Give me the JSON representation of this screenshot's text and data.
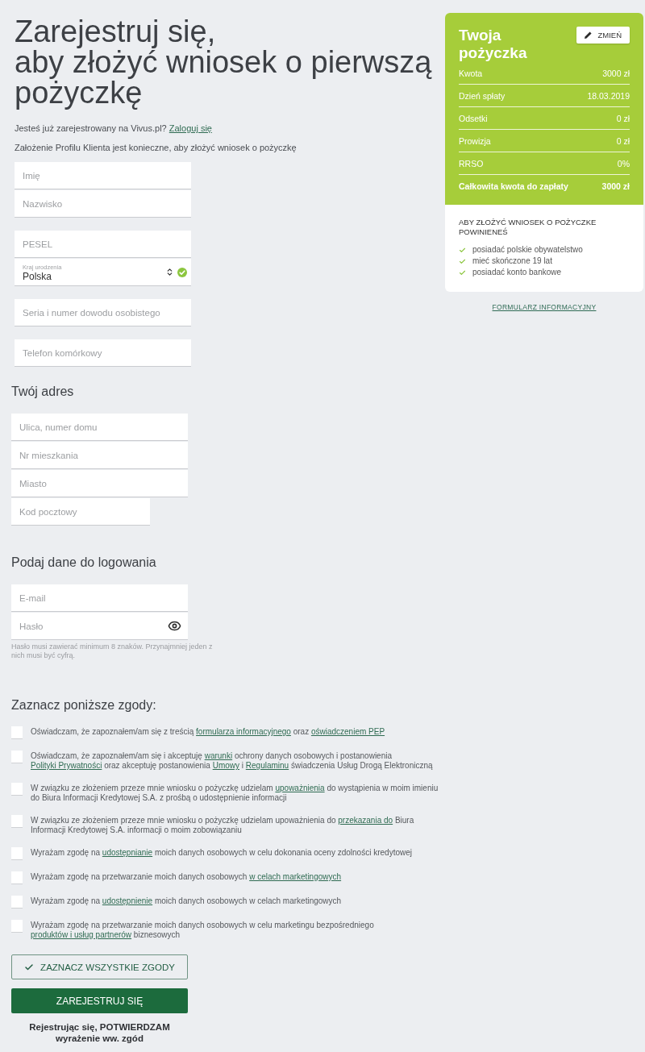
{
  "heading": "Zarejestruj się,\naby złożyć wniosek o pierwszą\npożyczkę",
  "login_prompt": [
    {
      "kind": "text",
      "text": "Jesteś już zarejestrowany na Vivus.pl? "
    },
    {
      "kind": "link",
      "text": "Zaloguj się"
    }
  ],
  "info_text": "Założenie Profilu Klienta jest konieczne, aby złożyć wniosek o pożyczkę",
  "personal_field_groups": [
    [
      {
        "kind": "text",
        "placeholder": "Imię"
      },
      {
        "kind": "text",
        "placeholder": "Nazwisko"
      }
    ],
    [
      {
        "kind": "text",
        "placeholder": "PESEL"
      },
      {
        "kind": "select",
        "label": "Kraj urodzenia",
        "value": "Polska",
        "valid": true
      }
    ],
    [
      {
        "kind": "text",
        "placeholder": "Seria i numer dowodu osobistego"
      }
    ],
    [
      {
        "kind": "text",
        "placeholder": "Telefon komórkowy"
      }
    ]
  ],
  "address": {
    "title": "Twój adres",
    "fields": [
      {
        "kind": "text",
        "placeholder": "Ulica, numer domu"
      },
      {
        "kind": "text",
        "placeholder": "Nr mieszkania"
      },
      {
        "kind": "text",
        "placeholder": "Miasto"
      },
      {
        "kind": "short",
        "placeholder": "Kod pocztowy"
      }
    ]
  },
  "login": {
    "title": "Podaj dane do logowania",
    "fields": [
      {
        "kind": "text",
        "placeholder": "E-mail"
      },
      {
        "kind": "password",
        "placeholder": "Hasło"
      }
    ],
    "hint": "Hasło musi zawierać minimum 8 znaków. Przynajmniej jeden z nich musi być cyfrą."
  },
  "consents": {
    "title": "Zaznacz poniższe zgody:",
    "items": [
      {
        "checked": false,
        "parts": [
          {
            "kind": "text",
            "text": "Oświadczam, że zapoznałem/am się z treścią "
          },
          {
            "kind": "link",
            "text": "formularza informacyjnego"
          },
          {
            "kind": "text",
            "text": " oraz "
          },
          {
            "kind": "link",
            "text": "oświadczeniem PEP"
          }
        ]
      },
      {
        "checked": false,
        "parts": [
          {
            "kind": "text",
            "text": "Oświadczam, że zapoznałem/am się i akceptuję "
          },
          {
            "kind": "link",
            "text": "warunki"
          },
          {
            "kind": "text",
            "text": " ochrony danych osobowych i postanowienia "
          },
          {
            "kind": "link",
            "text": "Polityki Prywatności"
          },
          {
            "kind": "text",
            "text": " oraz akceptuję postanowienia "
          },
          {
            "kind": "link",
            "text": "Umowy"
          },
          {
            "kind": "text",
            "text": " i "
          },
          {
            "kind": "link",
            "text": "Regulaminu"
          },
          {
            "kind": "text",
            "text": " świadczenia Usług Drogą Elektroniczną"
          }
        ]
      },
      {
        "checked": false,
        "parts": [
          {
            "kind": "text",
            "text": "W związku ze złożeniem przeze mnie wniosku o pożyczkę udzielam "
          },
          {
            "kind": "link",
            "text": "upoważnienia"
          },
          {
            "kind": "text",
            "text": " do wystąpienia w moim imieniu do Biura Informacji Kredytowej S.A. z prośbą o udostępnienie informacji"
          }
        ]
      },
      {
        "checked": false,
        "parts": [
          {
            "kind": "text",
            "text": "W związku ze złożeniem przeze mnie wniosku o pożyczkę udzielam upoważnienia do "
          },
          {
            "kind": "link",
            "text": "przekazania do"
          },
          {
            "kind": "text",
            "text": " Biura Informacji Kredytowej S.A. informacji o moim zobowiązaniu"
          }
        ]
      },
      {
        "checked": false,
        "parts": [
          {
            "kind": "text",
            "text": "Wyrażam zgodę na "
          },
          {
            "kind": "link",
            "text": "udostępnianie"
          },
          {
            "kind": "text",
            "text": " moich danych osobowych w celu dokonania oceny zdolności kredytowej"
          }
        ]
      },
      {
        "checked": false,
        "parts": [
          {
            "kind": "text",
            "text": "Wyrażam zgodę na przetwarzanie moich danych osobowych "
          },
          {
            "kind": "link",
            "text": "w celach marketingowych"
          }
        ]
      },
      {
        "checked": false,
        "parts": [
          {
            "kind": "text",
            "text": "Wyrażam zgodę na "
          },
          {
            "kind": "link",
            "text": "udostępnienie"
          },
          {
            "kind": "text",
            "text": " moich danych osobowych w celach marketingowych"
          }
        ]
      },
      {
        "checked": false,
        "parts": [
          {
            "kind": "text",
            "text": "Wyrażam zgodę na przetwarzanie moich danych osobowych w celu marketingu bezpośredniego "
          },
          {
            "kind": "link",
            "text": "produktów i usług partnerów"
          },
          {
            "kind": "text",
            "text": " biznesowych"
          }
        ]
      }
    ]
  },
  "select_all_button": "ZAZNACZ WSZYSTKIE ZGODY",
  "submit_button": "ZAREJESTRUJ SIĘ",
  "confirm_note": "Rejestrując się, POTWIERDZAM wyrażenie ww. zgód",
  "loan_card": {
    "title": "Twoja pożyczka",
    "change_button": "ZMIEŃ",
    "rows": [
      {
        "label": "Kwota",
        "value": "3000 zł",
        "total": false
      },
      {
        "label": "Dzień spłaty",
        "value": "18.03.2019",
        "total": false
      },
      {
        "label": "Odsetki",
        "value": "0 zł",
        "total": false
      },
      {
        "label": "Prowizja",
        "value": "0 zł",
        "total": false
      },
      {
        "label": "RRSO",
        "value": "0%",
        "total": false
      },
      {
        "label": "Całkowita kwota do zapłaty",
        "value": "3000 zł",
        "total": true
      }
    ],
    "requirements_title": "ABY ZŁOŻYĆ WNIOSEK O POŻYCZKE POWINIENEŚ",
    "requirements": [
      "posiadać polskie obywatelstwo",
      "mieć skończone 19 lat",
      "posiadać konto bankowe"
    ]
  },
  "info_form_link": "FORMULARZ INFORMACYJNY"
}
